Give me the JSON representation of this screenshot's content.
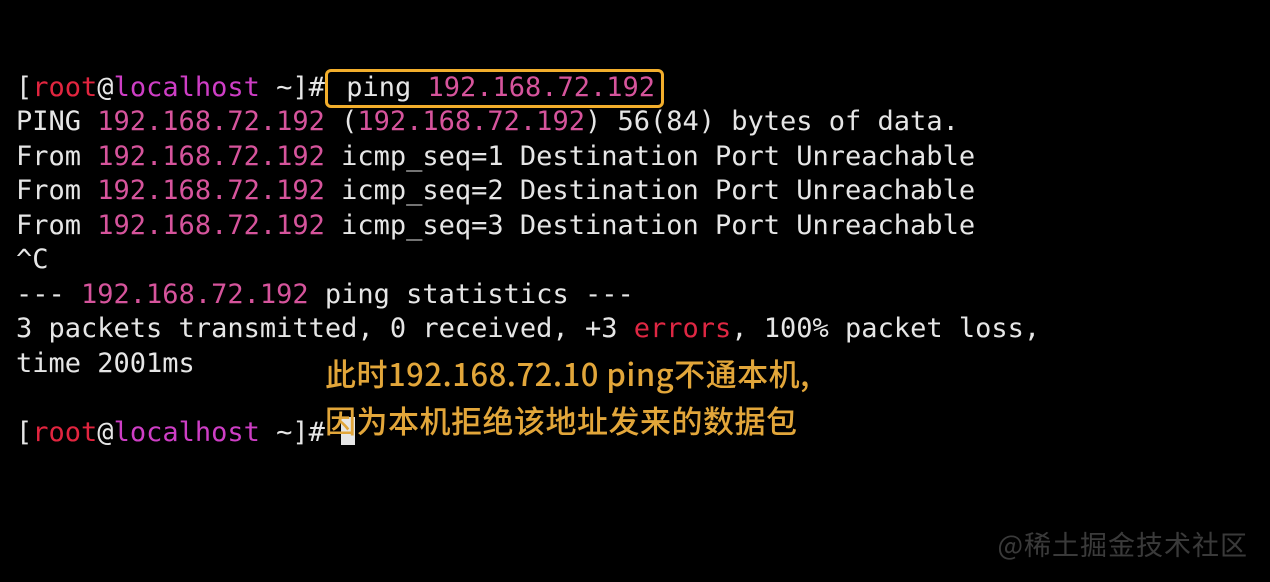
{
  "prompt1": {
    "lb": "[",
    "user": "root",
    "at": "@",
    "host": "localhost",
    "path": " ~",
    "rb": "]",
    "hash": "#",
    "sp": " ",
    "cmd": "ping",
    "sp2": " ",
    "ip": "192.168.72.192"
  },
  "out": {
    "ping_pre": "PING ",
    "ip": "192.168.72.192",
    "paren_open": " (",
    "ip2": "192.168.72.192",
    "paren_close_tail": ") 56(84) bytes of data.",
    "from": "From ",
    "seq1": " icmp_seq=1 Destination Port Unreachable",
    "seq2": " icmp_seq=2 Destination Port Unreachable",
    "seq3": " icmp_seq=3 Destination Port Unreachable",
    "ctrlc": "^C",
    "stats_pre": "--- ",
    "stats_post": " ping statistics ---",
    "summary_a": "3 packets transmitted, 0 received, +3 ",
    "summary_err": "errors",
    "summary_b": ", 100% packet loss,",
    "summary_line2": "time 2001ms"
  },
  "prompt2": {
    "lb": "[",
    "user": "root",
    "at": "@",
    "host": "localhost",
    "path": " ~",
    "rb": "]",
    "hash": "# "
  },
  "annotation": {
    "line1": "此时192.168.72.10 ping不通本机,",
    "line2": "因为本机拒绝该地址发来的数据包"
  },
  "watermark": "@稀土掘金技术社区"
}
